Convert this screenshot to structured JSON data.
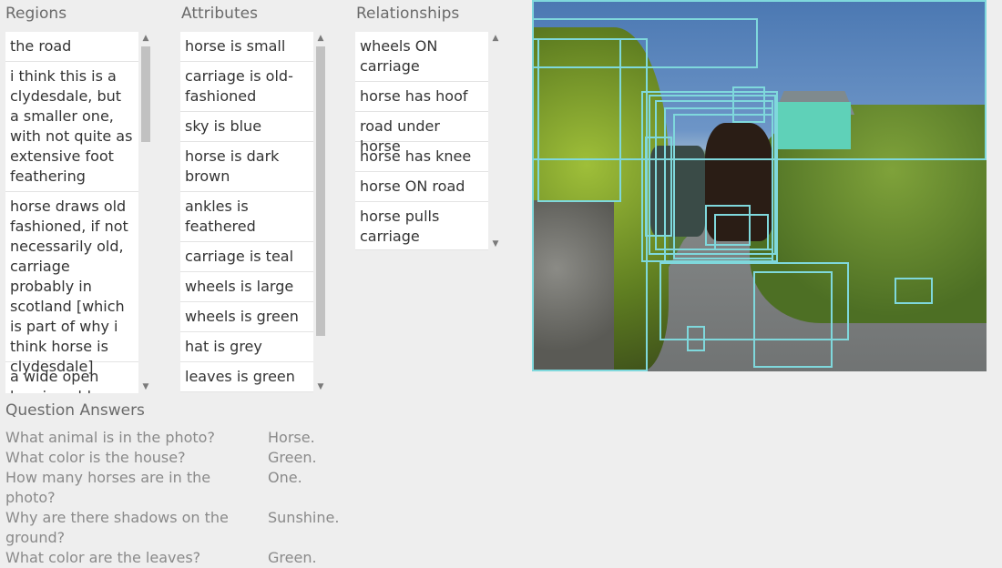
{
  "regions": {
    "title": "Regions",
    "items": [
      "the road",
      "i think this is a clydesdale, but a smaller one, with not quite as extensive foot feathering",
      "horse draws old fashioned, if not necessarily old, carriage probably in scotland [which is part of why i think horse is clydesdale]",
      "a wide open hemiyan blue sky"
    ]
  },
  "attributes": {
    "title": "Attributes",
    "items": [
      "horse is small",
      "carriage is old-fashioned",
      "sky is blue",
      "horse is dark brown",
      "ankles is feathered",
      "carriage is teal",
      "wheels is large",
      "wheels is green",
      "hat is grey",
      "leaves is green"
    ]
  },
  "relationships": {
    "title": "Relationships",
    "items": [
      "wheels ON carriage",
      "horse has hoof",
      "road under horse",
      "horse has knee",
      "horse ON road",
      "horse pulls carriage"
    ]
  },
  "qa": {
    "title": "Question Answers",
    "rows": [
      {
        "q": "What animal is in the photo?",
        "a": "Horse."
      },
      {
        "q": "What color is the house?",
        "a": "Green."
      },
      {
        "q": "How many horses are in the photo?",
        "a": "One."
      },
      {
        "q": "Why are there shadows on the ground?",
        "a": "Sunshine."
      },
      {
        "q": "What color are the leaves?",
        "a": "Green."
      }
    ]
  },
  "colors": {
    "bbox": "#7fd8dc",
    "background": "#eeeeee"
  },
  "icons": {
    "scroll_up": "scroll-up-arrow-icon",
    "scroll_down": "scroll-down-arrow-icon"
  }
}
